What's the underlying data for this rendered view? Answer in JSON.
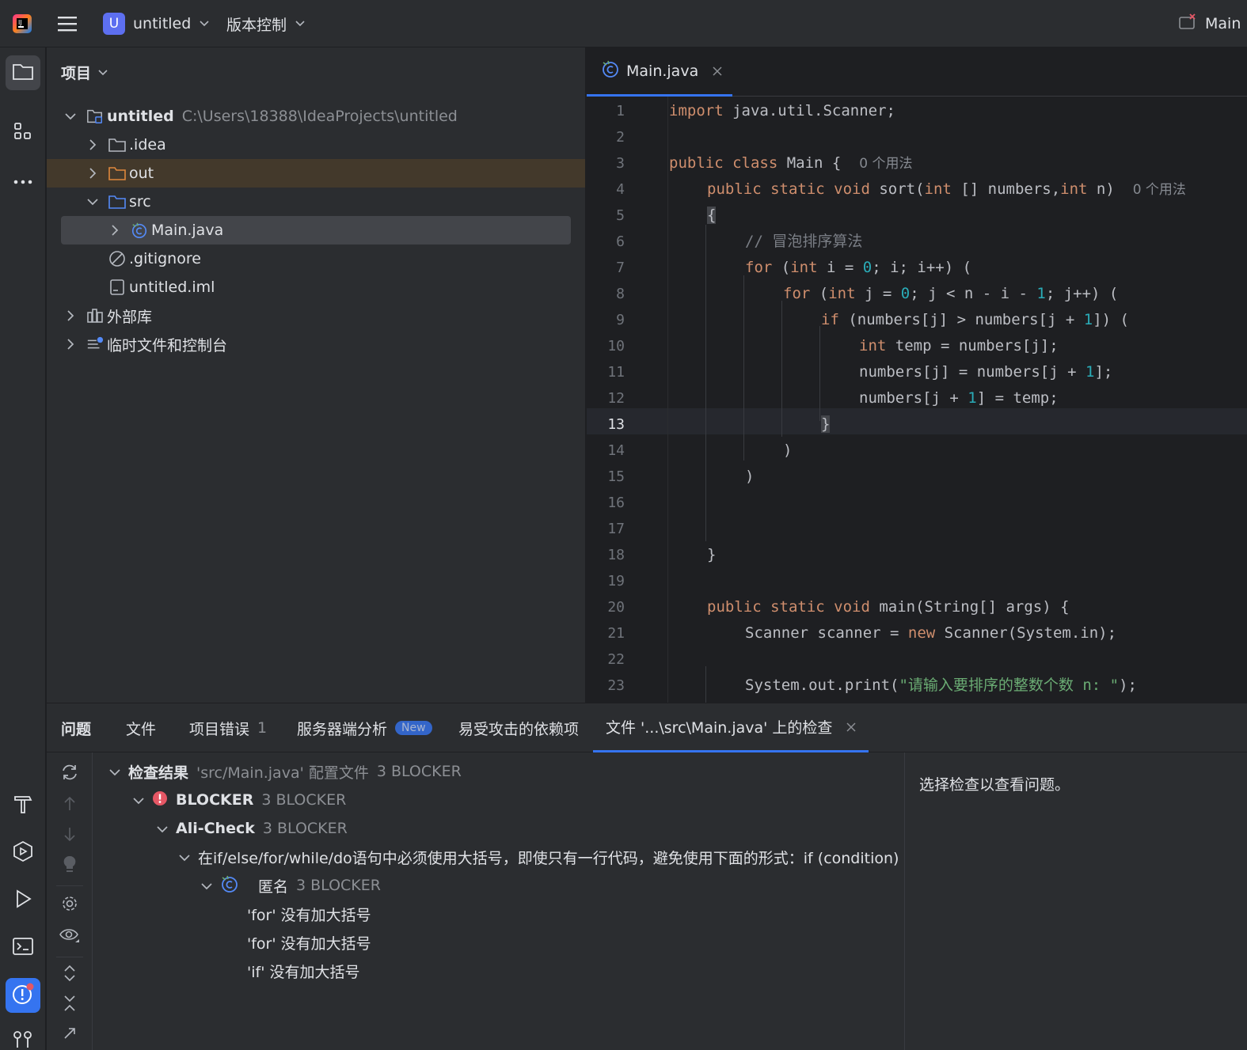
{
  "titlebar": {
    "project_badge": "U",
    "project_name": "untitled",
    "vcs_label": "版本控制",
    "run_config_label": "Main"
  },
  "project_panel": {
    "title": "项目",
    "tree": [
      {
        "label": "untitled",
        "path": "C:\\Users\\18388\\IdeaProjects\\untitled",
        "icon": "module-folder-icon"
      },
      {
        "label": ".idea",
        "icon": "folder-icon"
      },
      {
        "label": "out",
        "icon": "folder-icon"
      },
      {
        "label": "src",
        "icon": "folder-icon"
      },
      {
        "label": "Main.java",
        "icon": "java-class-icon"
      },
      {
        "label": ".gitignore",
        "icon": "ignore-file-icon"
      },
      {
        "label": "untitled.iml",
        "icon": "module-file-icon"
      },
      {
        "label": "外部库",
        "icon": "library-icon"
      },
      {
        "label": "临时文件和控制台",
        "icon": "scratches-icon"
      }
    ]
  },
  "editor": {
    "tab_label": "Main.java",
    "current_line": 13,
    "line_numbers": [
      "1",
      "2",
      "3",
      "4",
      "5",
      "6",
      "7",
      "8",
      "9",
      "10",
      "11",
      "12",
      "13",
      "14",
      "15",
      "16",
      "17",
      "18",
      "19",
      "20",
      "21",
      "22",
      "23"
    ],
    "code": {
      "l1_kw": "import",
      "l1_rest": " java.util.Scanner;",
      "l3_kw": "public class",
      "l3_rest": " Main {",
      "l3_hint": "0 个用法",
      "l4_kw": "public static void",
      "l4_a": " sort(",
      "l4_int1": "int",
      "l4_b": " [] numbers,",
      "l4_int2": "int",
      "l4_c": " n)",
      "l4_hint": "0 个用法",
      "l5": "{",
      "l6_comment": "// 冒泡排序算法",
      "l7_for": "for",
      "l7_a": " (",
      "l7_int": "int",
      "l7_b": " i = ",
      "l7_zero": "0",
      "l7_c": "; i; i++) (",
      "l8_for": "for",
      "l8_a": " (",
      "l8_int": "int",
      "l8_b": " j = ",
      "l8_zero": "0",
      "l8_c": "; j < n - i - ",
      "l8_one": "1",
      "l8_d": "; j++) (",
      "l9_if": "if",
      "l9_a": " (numbers[j] > numbers[j + ",
      "l9_one": "1",
      "l9_b": "]) (",
      "l10_int": "int",
      "l10_rest": " temp = numbers[j];",
      "l11_a": "numbers[j] = numbers[j + ",
      "l11_one": "1",
      "l11_b": "];",
      "l12_a": "numbers[j + ",
      "l12_one": "1",
      "l12_b": "] = temp;",
      "l13": "}",
      "l14": ")",
      "l15": ")",
      "l18": "}",
      "l20_kw": "public static void",
      "l20_rest": " main(String[] args) {",
      "l21_a": "Scanner scanner = ",
      "l21_new": "new",
      "l21_b": " Scanner(System.in);",
      "l23_a": "System.out.print(",
      "l23_str": "\"请输入要排序的整数个数 n: \"",
      "l23_b": ");"
    }
  },
  "problems": {
    "tabs": [
      {
        "label": "问题"
      },
      {
        "label": "文件"
      },
      {
        "label": "项目错误",
        "count": "1"
      },
      {
        "label": "服务器端分析",
        "badge": "New"
      },
      {
        "label": "易受攻击的依赖项"
      },
      {
        "label": "文件 '...\\src\\Main.java' 上的检查"
      }
    ],
    "tree": {
      "root_label": "检查结果",
      "root_meta": "'src/Main.java' 配置文件",
      "root_count": "3 BLOCKER",
      "blocker_label": "BLOCKER",
      "blocker_count": "3 BLOCKER",
      "check_label": "Ali-Check",
      "check_count": "3 BLOCKER",
      "rule_label": "在if/else/for/while/do语句中必须使用大括号，即使只有一行代码，避免使用下面的形式：if (condition) statements;",
      "anon_label": "匿名",
      "anon_count": "3 BLOCKER",
      "issues": [
        "'for' 没有加大括号",
        "'for' 没有加大括号",
        "'if' 没有加大括号"
      ]
    },
    "detail_text": "选择检查以查看问题。"
  },
  "colors": {
    "accent": "#3574f0",
    "keyword": "#cf8e6d",
    "number": "#2aacb8",
    "error": "#e55765",
    "background": "#1e1f22",
    "panel": "#2b2d30"
  }
}
